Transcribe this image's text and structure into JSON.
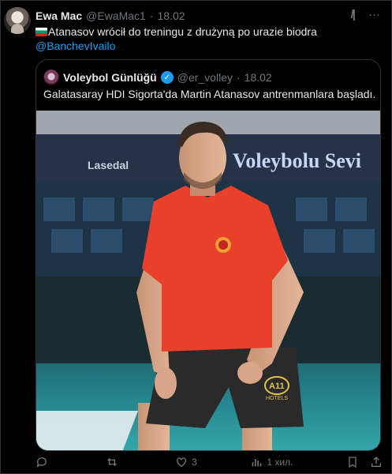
{
  "tweet": {
    "author_name": "Ewa Mac",
    "author_handle": "@EwaMac1",
    "separator": "·",
    "date": "18.02",
    "text": "Atanasov wrócił do treningu z drużyną po urazie biodra",
    "mention": "@BanchevIvailo",
    "icons": {
      "flag": "bulgaria-flag-icon",
      "grok": "grok-icon",
      "more": "more-icon"
    }
  },
  "quote": {
    "author_name": "Voleybol Günlüğü",
    "author_handle": "@er_volley",
    "separator": "·",
    "date": "18.02",
    "text": "Galatasaray HDI Sigorta'da Martin Atanasov antrenmanlara başladı.",
    "photo": {
      "banner_text": "Voleybolu Sevi",
      "banner_badge": "Lasedal",
      "shorts_logo": "A11",
      "shorts_logo_sub": "HOTELS"
    }
  },
  "actions": {
    "reply_count": "",
    "retweet_count": "",
    "like_count": "3",
    "views": "1 хил."
  },
  "colors": {
    "background": "#000000",
    "text": "#e7e9ea",
    "muted": "#71767b",
    "accent": "#1d9bf0",
    "shirt": "#e8402a"
  }
}
